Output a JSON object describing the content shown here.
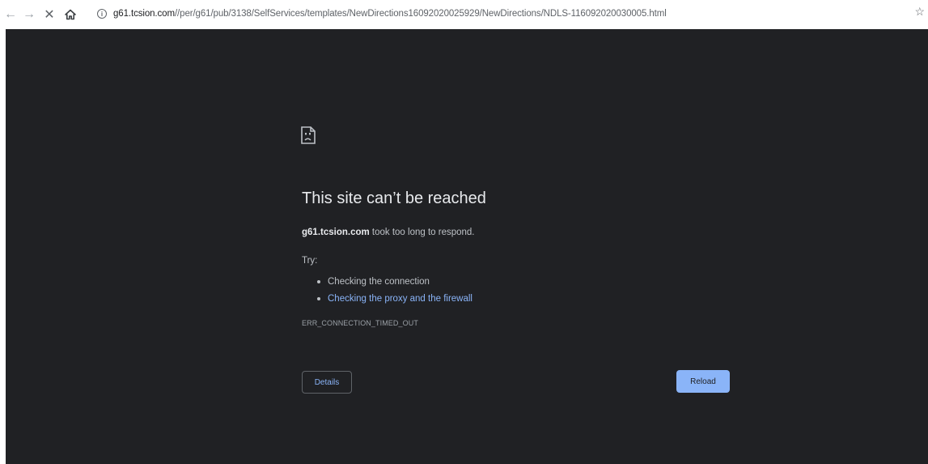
{
  "browser": {
    "back_icon": "←",
    "forward_icon": "→",
    "stop_icon": "✕",
    "home_icon": "⌂",
    "info_icon": "i",
    "url_host": "g61.tcsion.com",
    "url_path": "//per/g61/pub/3138/SelfServices/templates/NewDirections16092020025929/NewDirections/NDLS-116092020030005.html",
    "star_icon": "☆"
  },
  "error_page": {
    "title": "This site can’t be reached",
    "host": "g61.tcsion.com",
    "message": " took too long to respond.",
    "try_label": "Try:",
    "suggestions": [
      "Checking the connection",
      "Checking the proxy and the firewall"
    ],
    "error_code": "ERR_CONNECTION_TIMED_OUT",
    "details_button": "Details",
    "reload_button": "Reload"
  },
  "colors": {
    "page_bg": "#202124",
    "title": "#e8eaed",
    "text": "#bdc1c6",
    "link": "#8ab4f8",
    "reload_bg": "#8ab4f8"
  }
}
